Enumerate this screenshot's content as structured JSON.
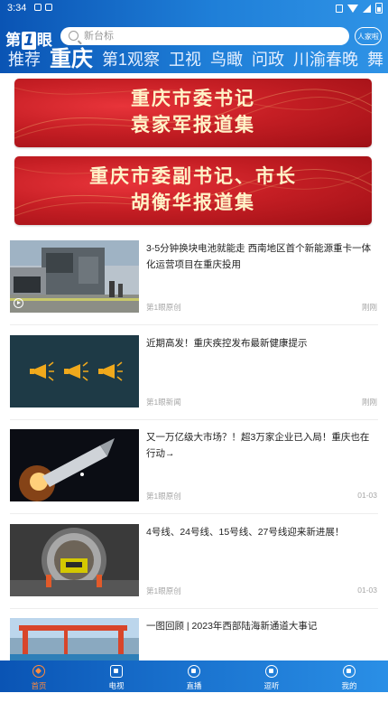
{
  "status": {
    "time": "3:34"
  },
  "header": {
    "logo_left": "第",
    "logo_mid": "1",
    "logo_right": "眼",
    "search_placeholder": "新台标",
    "badge": "人家啦"
  },
  "tabs": [
    {
      "label": "推荐",
      "active": false
    },
    {
      "label": "重庆",
      "active": true
    },
    {
      "label": "第1观察",
      "active": false
    },
    {
      "label": "卫视",
      "active": false
    },
    {
      "label": "鸟瞰",
      "active": false
    },
    {
      "label": "问政",
      "active": false
    },
    {
      "label": "川渝春晚",
      "active": false
    },
    {
      "label": "舞",
      "active": false
    }
  ],
  "banners": [
    {
      "line1": "重庆市委书记",
      "line2": "袁家军报道集"
    },
    {
      "line1": "重庆市委副书记、市长",
      "line2": "胡衡华报道集"
    }
  ],
  "news": [
    {
      "title": "3-5分钟换块电池就能走 西南地区首个新能源重卡一体化运营项目在重庆投用",
      "source": "第1眼原创",
      "time": "刚刚"
    },
    {
      "title": "近期高发！重庆疾控发布最新健康提示",
      "source": "第1眼新闻",
      "time": "刚刚"
    },
    {
      "title": "又一万亿级大市场？！超3万家企业已入局！重庆也在行动→",
      "source": "第1眼原创",
      "time": "01-03"
    },
    {
      "title": "4号线、24号线、15号线、27号线迎来新进展！",
      "source": "第1眼原创",
      "time": "01-03"
    },
    {
      "title": "一图回顾 | 2023年西部陆海新通道大事记",
      "source": "",
      "time": ""
    }
  ],
  "bottom_nav": [
    {
      "label": "首页",
      "icon": "star-icon",
      "active": true
    },
    {
      "label": "电视",
      "icon": "tv-icon",
      "active": false
    },
    {
      "label": "直播",
      "icon": "lightning-icon",
      "active": false
    },
    {
      "label": "逗听",
      "icon": "radio-icon",
      "active": false
    },
    {
      "label": "我的",
      "icon": "user-icon",
      "active": false
    }
  ],
  "colors": {
    "header_blue": "#0a54b4",
    "banner_red": "#c51e24",
    "active_orange": "#ff8a3d"
  }
}
